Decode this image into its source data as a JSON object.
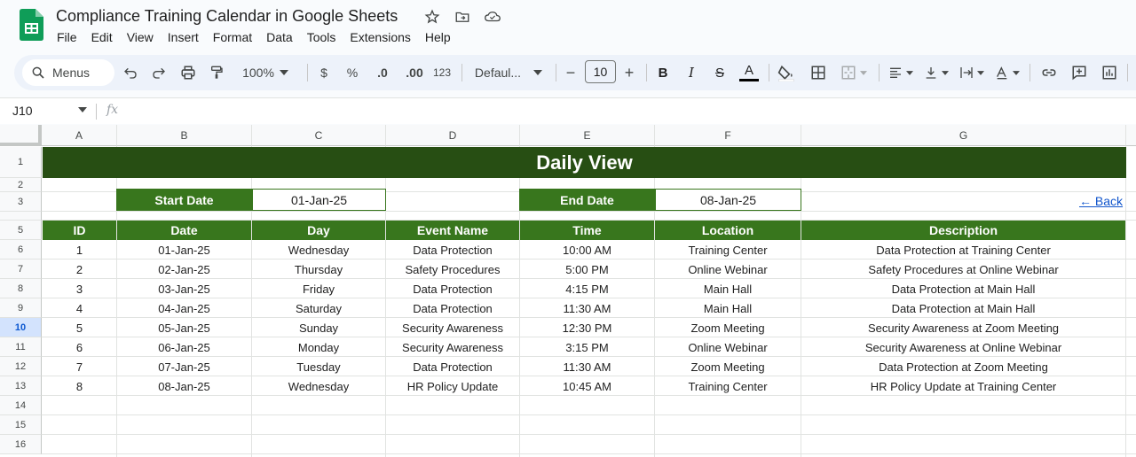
{
  "window": {
    "title": "Compliance Training Calendar in Google Sheets"
  },
  "menu": [
    "File",
    "Edit",
    "View",
    "Insert",
    "Format",
    "Data",
    "Tools",
    "Extensions",
    "Help"
  ],
  "toolbar": {
    "search_label": "Menus",
    "zoom": "100%",
    "currency": "$",
    "percent": "%",
    "decrease_decimal": ".0",
    "increase_decimal": ".00",
    "number_format": "123",
    "font": "Defaul...",
    "font_size": "10",
    "minus": "−",
    "plus": "+",
    "bold": "B",
    "italic": "I",
    "strike": "S",
    "text_color": "A"
  },
  "formula_bar": {
    "cell_ref": "J10",
    "fx": "fx"
  },
  "columns": [
    "A",
    "B",
    "C",
    "D",
    "E",
    "F",
    "G"
  ],
  "rows": [
    "1",
    "2",
    "3",
    "5",
    "6",
    "7",
    "8",
    "9",
    "10",
    "11",
    "12",
    "13",
    "14",
    "15",
    "16"
  ],
  "active_row": "10",
  "sheet": {
    "banner": "Daily View",
    "start_label": "Start Date",
    "start_value": "01-Jan-25",
    "end_label": "End Date",
    "end_value": "08-Jan-25",
    "back_link": "← Back",
    "headers": [
      "ID",
      "Date",
      "Day",
      "Event Name",
      "Time",
      "Location",
      "Description"
    ],
    "records": [
      [
        "1",
        "01-Jan-25",
        "Wednesday",
        "Data Protection",
        "10:00 AM",
        "Training Center",
        "Data Protection at Training Center"
      ],
      [
        "2",
        "02-Jan-25",
        "Thursday",
        "Safety Procedures",
        "5:00 PM",
        "Online Webinar",
        "Safety Procedures at Online Webinar"
      ],
      [
        "3",
        "03-Jan-25",
        "Friday",
        "Data Protection",
        "4:15 PM",
        "Main Hall",
        "Data Protection at Main Hall"
      ],
      [
        "4",
        "04-Jan-25",
        "Saturday",
        "Data Protection",
        "11:30 AM",
        "Main Hall",
        "Data Protection at Main Hall"
      ],
      [
        "5",
        "05-Jan-25",
        "Sunday",
        "Security Awareness",
        "12:30 PM",
        "Zoom Meeting",
        "Security Awareness at Zoom Meeting"
      ],
      [
        "6",
        "06-Jan-25",
        "Monday",
        "Security Awareness",
        "3:15 PM",
        "Online Webinar",
        "Security Awareness at Online Webinar"
      ],
      [
        "7",
        "07-Jan-25",
        "Tuesday",
        "Data Protection",
        "11:30 AM",
        "Zoom Meeting",
        "Data Protection at Zoom Meeting"
      ],
      [
        "8",
        "08-Jan-25",
        "Wednesday",
        "HR Policy Update",
        "10:45 AM",
        "Training Center",
        "HR Policy Update at Training Center"
      ]
    ]
  },
  "colors": {
    "banner": "#274e13",
    "header": "#38761d",
    "link": "#1155cc"
  }
}
